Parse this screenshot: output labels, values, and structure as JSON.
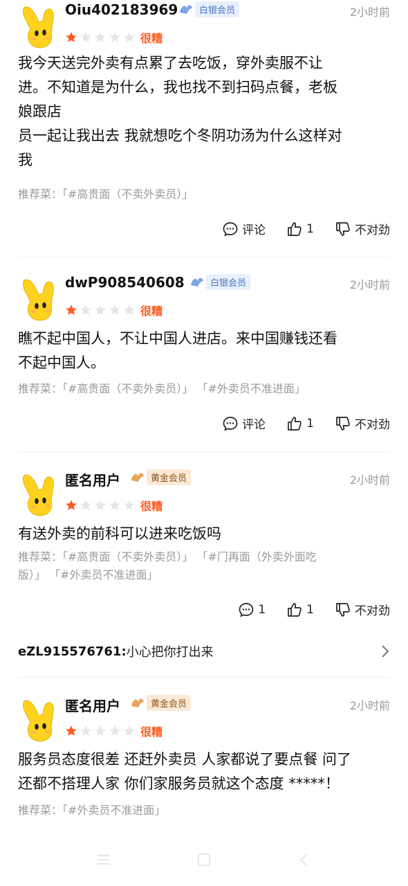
{
  "reviews": [
    {
      "username": "Oiu402183969",
      "badge": "白银会员",
      "badge_type": "silver",
      "time": "2小时前",
      "rating": 1,
      "rating_max": 5,
      "rating_label": "很糟",
      "content_lines": [
        "我今天送完外卖有点累了去吃饭，穿外卖服不让",
        "进。不知道是为什么，我也找不到扫码点餐，老板",
        "娘跟店",
        "员一起让我出去  我就想吃个冬阴功汤为什么这样对",
        "我"
      ],
      "dish_lines": [
        "推荐菜：「#高贵面（不卖外卖员）」"
      ],
      "comment_label": "评论",
      "like_count": "1",
      "dislike_label": "不对劲"
    },
    {
      "username": "dwP908540608",
      "badge": "白银会员",
      "badge_type": "silver",
      "time": "2小时前",
      "rating": 1,
      "rating_max": 5,
      "rating_label": "很糟",
      "content_lines": [
        "瞧不起中国人，不让中国人进店。来中国赚钱还看",
        "不起中国人。"
      ],
      "dish_lines": [
        "推荐菜：「#高贵面（不卖外卖员）」 「#外卖员不准进面」"
      ],
      "comment_label": "评论",
      "like_count": "1",
      "dislike_label": "不对劲"
    },
    {
      "username": "匿名用户",
      "badge": "黄金会员",
      "badge_type": "gold",
      "time": "2小时前",
      "rating": 1,
      "rating_max": 5,
      "rating_label": "很糟",
      "content_lines": [
        "有送外卖的前科可以进来吃饭吗"
      ],
      "dish_lines": [
        "推荐菜：「#高贵面（不卖外卖员）」 「#门再面（外卖外面吃",
        "版）」 「#外卖员不准进面」"
      ],
      "comment_count": "1",
      "like_count": "1",
      "dislike_label": "不对劲",
      "reply": {
        "user": "eZL915576761:",
        "text": " 小心把你打出来"
      }
    },
    {
      "username": "匿名用户",
      "badge": "黄金会员",
      "badge_type": "gold",
      "time": "2小时前",
      "rating": 1,
      "rating_max": 5,
      "rating_label": "很糟",
      "content_lines": [
        "服务员态度很差 还赶外卖员 人家都说了要点餐 问了",
        "还都不搭理人家 你们家服务员就这个态度 *****！"
      ],
      "dish_lines": [
        "推荐菜：「#外卖员不准进面」"
      ]
    }
  ],
  "colors": {
    "star_on": "#ff5b1f",
    "star_off": "#e6e6e6",
    "rating_label": "#ff5b1f",
    "silver_badge": "#4a74c6",
    "gold_badge": "#8a5418",
    "avatar_yellow": "#ffd21e"
  },
  "icons": {
    "comment": "comment-icon",
    "like": "thumbs-up-icon",
    "dislike": "thumbs-down-icon",
    "reply_more": "chevron-right-icon",
    "nav": [
      "menu-icon",
      "home-square-icon",
      "back-icon"
    ]
  }
}
